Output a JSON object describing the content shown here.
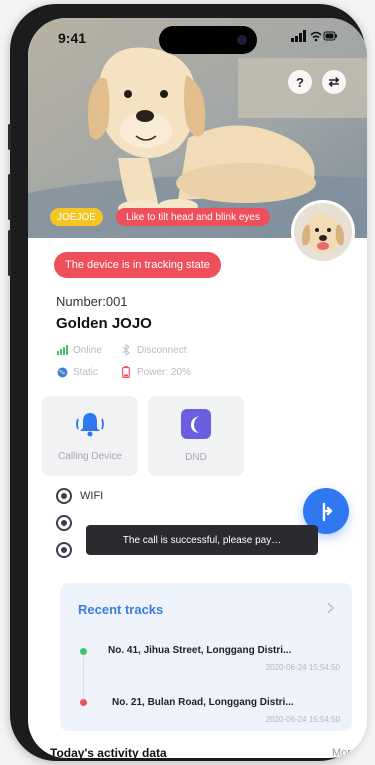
{
  "status_bar": {
    "time": "9:41",
    "icons": "▮▮▮ ◠ ▭"
  },
  "hero": {
    "help_icon": "?",
    "switch_icon": "⇄",
    "dog_tag": "JOEJOE",
    "action_hint": "Like to tilt head and blink eyes"
  },
  "device": {
    "tracking_state": "The device is in tracking state",
    "number": "Number:001",
    "name": "Golden JOJO",
    "stats": [
      {
        "icon": "signal-icon",
        "label": "Online",
        "color": "#45c469"
      },
      {
        "icon": "bluetooth-icon",
        "label": "Disconnect",
        "color": "#c5c8ce"
      },
      {
        "icon": "globe-icon",
        "label": "Static",
        "color": "#3f7ee8"
      },
      {
        "icon": "battery-icon",
        "label": "Power: 20%",
        "color": "#ef4f5a"
      }
    ]
  },
  "tiles": {
    "calling": "Calling Device",
    "dnd": "DND"
  },
  "connection": {
    "wifi": "WIFI"
  },
  "toast": "The call is successful, please pay…",
  "recent_tracks": {
    "title": "Recent tracks",
    "items": [
      {
        "address": "No. 41, Jihua Street, Longgang Distri...",
        "time": "2020-06-24 15:54:50",
        "dot_color": "#45c469"
      },
      {
        "address": "No. 21, Bulan Road, Longgang Distri...",
        "time": "2020-06-24 15:54:50",
        "dot_color": "#ef4f5a"
      }
    ]
  },
  "activity": {
    "title": "Today's activity data",
    "more": "More"
  },
  "colors": {
    "accent_blue": "#2f78f0",
    "alert_red": "#ef4f5a",
    "tag_yellow": "#f3c623"
  }
}
